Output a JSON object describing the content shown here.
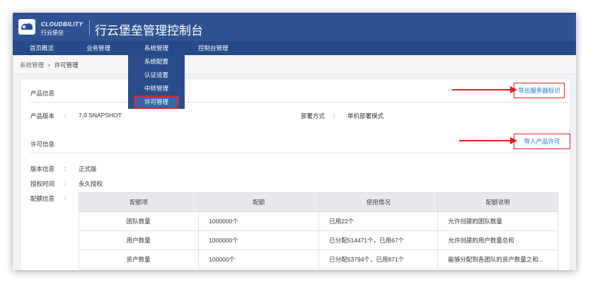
{
  "header": {
    "brand_en": "CLOUDBILITY",
    "brand_cn": "行云堡垒",
    "title": "行云堡垒管理控制台"
  },
  "nav": {
    "items": [
      "首页概览",
      "业务管理",
      "系统管理",
      "控制台管理"
    ]
  },
  "dropdown": {
    "items": [
      "系统配置",
      "认证设置",
      "中转管理",
      "许可管理"
    ],
    "active": "许可管理"
  },
  "breadcrumb": {
    "parent": "系统管理",
    "sep": ">",
    "current": "许可管理"
  },
  "product": {
    "section_title": "产品信息",
    "export_button": "导出服务器标识",
    "version_label": "产品版本",
    "version_value": "7.0 SNAPSHOT",
    "deploy_label": "部署方式",
    "deploy_value": "单机部署模式",
    "colon": ":"
  },
  "license": {
    "section_title": "许可信息",
    "import_button": "导入产品许可",
    "edition_label": "版本信息",
    "edition_value": "正式版",
    "auth_time_label": "授权时间",
    "auth_time_value": "永久授权",
    "quota_label": "配额信息",
    "colon": ":"
  },
  "quota_table": {
    "headers": [
      "配额项",
      "配额",
      "使用情况",
      "配额说明"
    ],
    "rows": [
      [
        "团队数量",
        "1000000个",
        "已用22个",
        "允许创建的团队数量"
      ],
      [
        "用户数量",
        "1000000个",
        "已分配514471个，已用67个",
        "允许创建的用户数量总和"
      ],
      [
        "资产数量",
        "100000个",
        "已分配53794个，已用871个",
        "能够分配到各团队的资产数量之和..."
      ]
    ]
  },
  "colors": {
    "header_bg": "#2f5392",
    "nav_bg": "#264a87",
    "link": "#1a78d2",
    "annotation_red": "#e02020"
  }
}
